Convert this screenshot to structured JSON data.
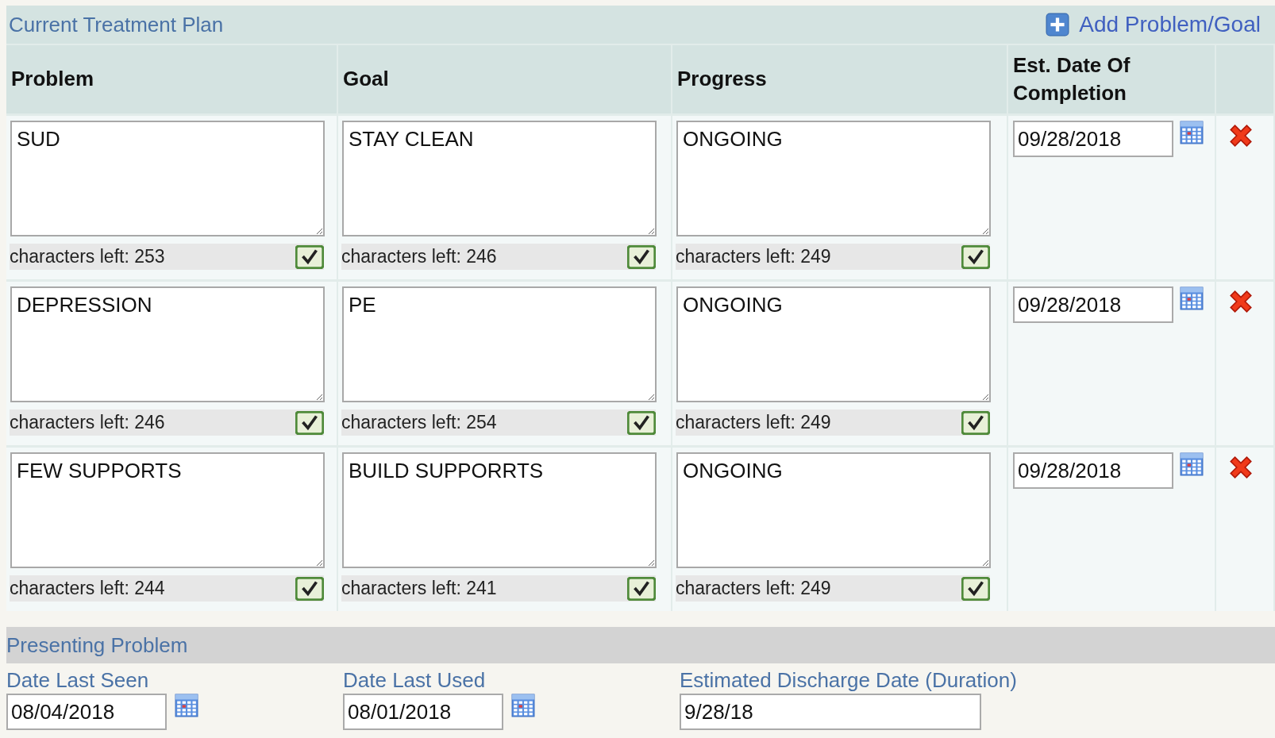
{
  "section": {
    "title": "Current Treatment Plan",
    "add_link": "Add Problem/Goal"
  },
  "table": {
    "columns": [
      "Problem",
      "Goal",
      "Progress",
      "Est. Date Of Completion"
    ],
    "rows": [
      {
        "cells": [
          {
            "value": "SUD",
            "chars_left": "characters left: 253"
          },
          {
            "value": "STAY CLEAN",
            "chars_left": "characters left: 246"
          },
          {
            "value": "ONGOING",
            "chars_left": "characters left: 249"
          }
        ],
        "est_date": "09/28/2018"
      },
      {
        "cells": [
          {
            "value": "DEPRESSION",
            "chars_left": "characters left: 246"
          },
          {
            "value": "PE",
            "chars_left": "characters left: 254"
          },
          {
            "value": "ONGOING",
            "chars_left": "characters left: 249"
          }
        ],
        "est_date": "09/28/2018"
      },
      {
        "cells": [
          {
            "value": "FEW SUPPORTS",
            "chars_left": "characters left: 244"
          },
          {
            "value": "BUILD SUPPORRTS",
            "chars_left": "characters left: 241"
          },
          {
            "value": "ONGOING",
            "chars_left": "characters left: 249"
          }
        ],
        "est_date": "09/28/2018"
      }
    ]
  },
  "presenting_problem": {
    "title": "Presenting Problem",
    "fields": [
      {
        "label": "Date Last Seen",
        "value": "08/04/2018",
        "kind": "date"
      },
      {
        "label": "Date Last Used",
        "value": "08/01/2018",
        "kind": "date"
      },
      {
        "label": "Estimated Discharge Date (Duration)",
        "value": "9/28/18",
        "kind": "text"
      }
    ]
  }
}
